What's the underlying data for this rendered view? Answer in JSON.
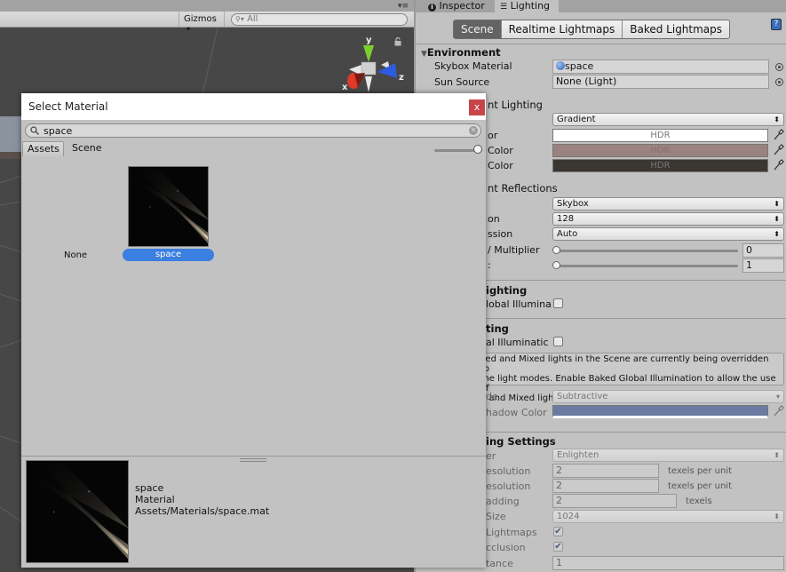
{
  "scene_view": {
    "gizmos_label": "Gizmos",
    "gizmos_arrow": "▾",
    "search_placeholder": "All",
    "axis_labels": {
      "x": "x",
      "y": "y",
      "z": "z"
    },
    "panel_menu": "▾≡"
  },
  "inspector": {
    "tabs": [
      {
        "icon": "info-icon",
        "label": "Inspector",
        "active": false
      },
      {
        "icon": "lighting-icon",
        "label": "Lighting",
        "active": true
      }
    ],
    "mode_buttons": [
      {
        "label": "Scene",
        "active": true
      },
      {
        "label": "Realtime Lightmaps",
        "active": false
      },
      {
        "label": "Baked Lightmaps",
        "active": false
      }
    ],
    "help_icon": "?",
    "environment": {
      "title": "Environment",
      "skybox_label": "Skybox Material",
      "skybox_value": "space",
      "sun_label": "Sun Source",
      "sun_value": "None (Light)"
    },
    "ambient_lighting": {
      "title": "nt Lighting",
      "source_value": "Gradient",
      "rows": [
        {
          "label": "or",
          "value": "HDR",
          "color": "#ffffff",
          "text_color": "#777777"
        },
        {
          "label": "Color",
          "value": "HDR",
          "color": "#9a8280",
          "text_color": "#8a7270"
        },
        {
          "label": "Color",
          "value": "HDR",
          "color": "#3a3632",
          "text_color": "#777777"
        }
      ]
    },
    "reflections": {
      "title": "nt Reflections",
      "source_value": "Skybox",
      "resolution_label": "on",
      "resolution_value": "128",
      "compression_label": "ssion",
      "compression_value": "Auto",
      "intensity_label": "/ Multiplier",
      "intensity_value": "0",
      "bounces_label": ":",
      "bounces_value": "1"
    },
    "realtime_lighting": {
      "title": "ighting",
      "gi_label": "lobal Illumina",
      "gi_checked": false
    },
    "mixed_lighting": {
      "title": "ting",
      "gi_label": "al Illuminatic",
      "gi_checked": false,
      "help_lines": [
        "ked and Mixed lights in the Scene are currently being overridden to",
        "me light modes. Enable Baked Global Illumination to allow the use of",
        "d and Mixed light modes."
      ],
      "mode_label": "de",
      "mode_value": "Subtractive",
      "shadow_label": "hadow Color",
      "shadow_color": "#6b7aa1"
    },
    "lightmapping": {
      "title": "ing Settings",
      "lightmapper_label": "er",
      "lightmapper_value": "Enlighten",
      "indirect_res_label": "esolution",
      "indirect_res_value": "2",
      "indirect_res_unit": "texels per unit",
      "lightmap_res_label": "esolution",
      "lightmap_res_value": "2",
      "lightmap_res_unit": "texels per unit",
      "padding_label": "adding",
      "padding_value": "2",
      "padding_unit": "texels",
      "size_label": "Size",
      "size_value": "1024",
      "compress_label": "Lightmaps",
      "compress_checked": true,
      "ao_label": "cclusion",
      "ao_checked": true,
      "distance_label": "tance",
      "distance_value": "1"
    }
  },
  "dialog": {
    "title": "Select Material",
    "close_label": "x",
    "search_value": "space",
    "tabs": [
      {
        "label": "Assets",
        "active": true
      },
      {
        "label": "Scene",
        "active": false
      }
    ],
    "zoom_level": 1.0,
    "items": [
      {
        "label": "None",
        "selected": false
      },
      {
        "label": "space",
        "selected": true
      }
    ],
    "preview": {
      "name": "space",
      "type": "Material",
      "path": "Assets/Materials/space.mat"
    }
  }
}
